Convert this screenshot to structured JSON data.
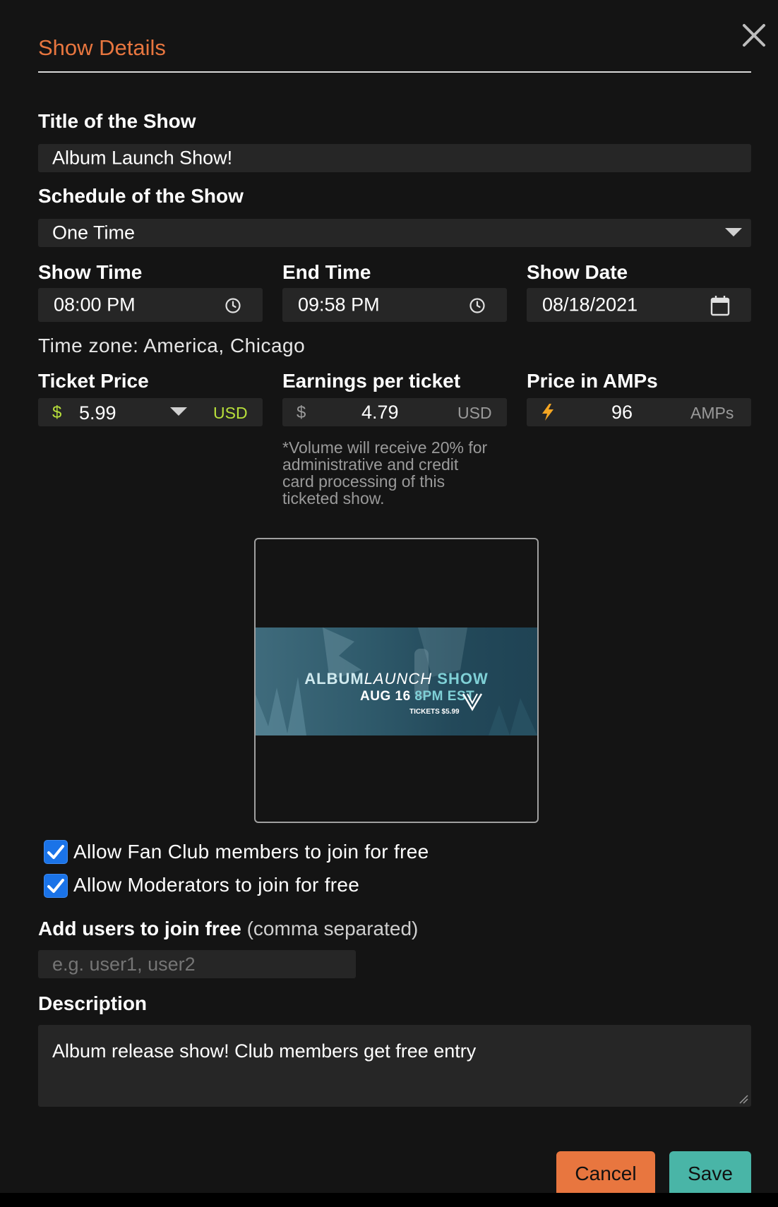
{
  "modal": {
    "title": "Show Details",
    "close_label": "×"
  },
  "form": {
    "title_label": "Title of the Show",
    "title_value": "Album Launch Show!",
    "schedule_label": "Schedule of the Show",
    "schedule_value": "One Time",
    "show_time_label": "Show Time",
    "show_time_value": "08:00  PM",
    "end_time_label": "End Time",
    "end_time_value": "09:58  PM",
    "show_date_label": "Show Date",
    "show_date_value": "08/18/2021",
    "timezone": "Time zone: America, Chicago",
    "ticket_price_label": "Ticket Price",
    "ticket_currency_symbol": "$",
    "ticket_price_value": "5.99",
    "ticket_currency": "USD",
    "earnings_label": "Earnings per ticket",
    "earnings_currency_symbol": "$",
    "earnings_value": "4.79",
    "earnings_currency": "USD",
    "amps_label": "Price in AMPs",
    "amps_value": "96",
    "amps_unit": "AMPs",
    "fee_note": "*Volume will receive 20% for administrative and credit card processing of this ticketed show.",
    "fan_club_checkbox_label": "Allow Fan Club members to join for free",
    "fan_club_checked": true,
    "moderators_checkbox_label": "Allow Moderators to join for free",
    "moderators_checked": true,
    "free_users_label": "Add users to join free",
    "free_users_hint": "(comma separated)",
    "free_users_placeholder": "e.g. user1, user2",
    "free_users_value": "",
    "description_label": "Description",
    "description_value": "Album release show!  Club members get free entry"
  },
  "poster": {
    "title_part1": "ALBUM",
    "title_part2": "LAUNCH",
    "title_part3": "SHOW",
    "date_part1": "AUG 16",
    "date_part2": "8PM EST",
    "tickets": "TICKETS $5.99"
  },
  "buttons": {
    "cancel": "Cancel",
    "save": "Save"
  },
  "colors": {
    "accent_orange": "#e8763f",
    "save_teal": "#49b5a7",
    "checkbox_blue": "#1a73e8",
    "usd_green": "#b8e03b",
    "amps_bolt": "#f5a623"
  },
  "icons": {
    "close": "close-icon",
    "dropdown": "caret-down-icon",
    "clock": "clock-icon",
    "calendar": "calendar-icon",
    "bolt": "bolt-icon",
    "checkbox": "checkmark-icon"
  }
}
